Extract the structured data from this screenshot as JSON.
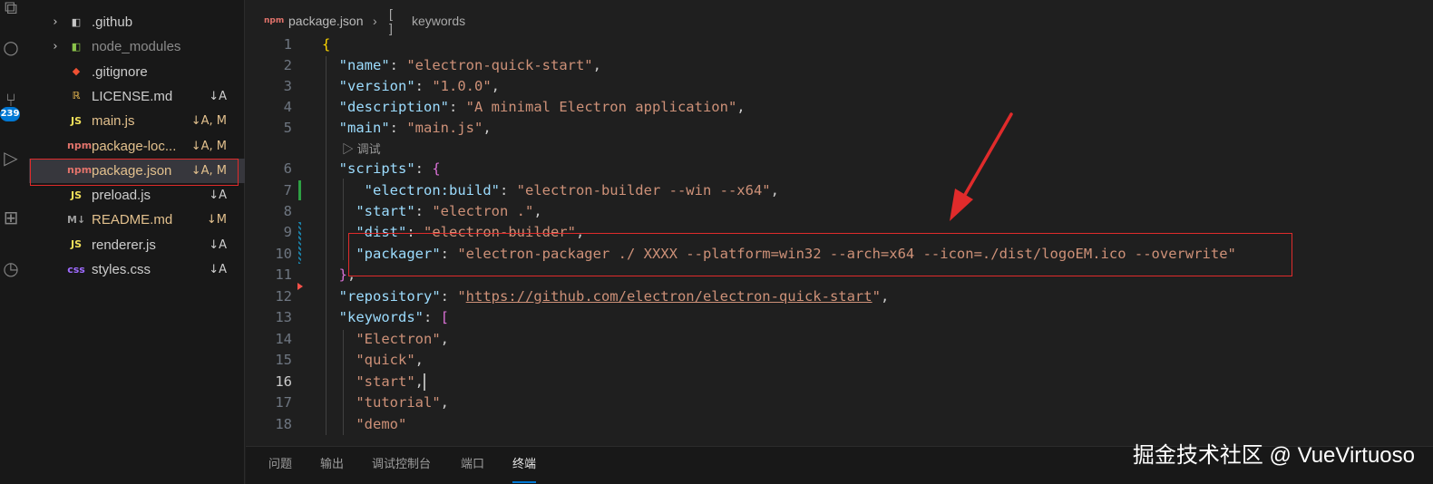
{
  "explorer": {
    "items": [
      {
        "name": ".github",
        "icon": "folder-github-icon",
        "status": "",
        "chevron": "›"
      },
      {
        "name": "node_modules",
        "icon": "folder-node-icon",
        "status": "",
        "chevron": "›"
      },
      {
        "name": ".gitignore",
        "icon": "git-icon",
        "status": ""
      },
      {
        "name": "LICENSE.md",
        "icon": "license-icon",
        "status": "↓A"
      },
      {
        "name": "main.js",
        "icon": "js-icon",
        "icon_text": "JS",
        "status": "↓A, M"
      },
      {
        "name": "package-loc...",
        "icon": "npm-icon",
        "icon_text": "npm",
        "status": "↓A, M"
      },
      {
        "name": "package.json",
        "icon": "npm-icon",
        "icon_text": "npm",
        "status": "↓A, M"
      },
      {
        "name": "preload.js",
        "icon": "js-icon",
        "icon_text": "JS",
        "status": "↓A"
      },
      {
        "name": "README.md",
        "icon": "markdown-icon",
        "icon_text": "M↓",
        "status": "↓M"
      },
      {
        "name": "renderer.js",
        "icon": "js-icon",
        "icon_text": "JS",
        "status": "↓A"
      },
      {
        "name": "styles.css",
        "icon": "css-icon",
        "icon_text": "css",
        "status": "↓A"
      }
    ]
  },
  "activity": {
    "badge": "239",
    "icons": [
      "explorer-icon",
      "search-icon",
      "source-control-icon",
      "run-debug-icon",
      "extensions-icon",
      "timeline-icon"
    ]
  },
  "breadcrumb": {
    "file": "package.json",
    "separator": "›",
    "symbol_icon": "[ ]",
    "symbol": "keywords"
  },
  "editor": {
    "codelens": "▷ 调试",
    "lines": [
      {
        "n": "1",
        "tokens": [
          [
            "b1",
            "{"
          ]
        ]
      },
      {
        "n": "2",
        "tokens": [
          [
            "p",
            "  "
          ],
          [
            "k",
            "\"name\""
          ],
          [
            "p",
            ": "
          ],
          [
            "s",
            "\"electron-quick-start\""
          ],
          [
            "p",
            ","
          ]
        ]
      },
      {
        "n": "3",
        "tokens": [
          [
            "p",
            "  "
          ],
          [
            "k",
            "\"version\""
          ],
          [
            "p",
            ": "
          ],
          [
            "s",
            "\"1.0.0\""
          ],
          [
            "p",
            ","
          ]
        ]
      },
      {
        "n": "4",
        "tokens": [
          [
            "p",
            "  "
          ],
          [
            "k",
            "\"description\""
          ],
          [
            "p",
            ": "
          ],
          [
            "s",
            "\"A minimal Electron application\""
          ],
          [
            "p",
            ","
          ]
        ]
      },
      {
        "n": "5",
        "tokens": [
          [
            "p",
            "  "
          ],
          [
            "k",
            "\"main\""
          ],
          [
            "p",
            ": "
          ],
          [
            "s",
            "\"main.js\""
          ],
          [
            "p",
            ","
          ]
        ]
      },
      {
        "n": "6",
        "tokens": [
          [
            "p",
            "  "
          ],
          [
            "k",
            "\"scripts\""
          ],
          [
            "p",
            ": "
          ],
          [
            "b2",
            "{"
          ]
        ]
      },
      {
        "n": "7",
        "tokens": [
          [
            "p",
            "     "
          ],
          [
            "k",
            "\"electron:build\""
          ],
          [
            "p",
            ": "
          ],
          [
            "s",
            "\"electron-builder --win --x64\""
          ],
          [
            "p",
            ","
          ]
        ]
      },
      {
        "n": "8",
        "tokens": [
          [
            "p",
            "    "
          ],
          [
            "k",
            "\"start\""
          ],
          [
            "p",
            ": "
          ],
          [
            "s",
            "\"electron .\""
          ],
          [
            "p",
            ","
          ]
        ]
      },
      {
        "n": "9",
        "tokens": [
          [
            "p",
            "    "
          ],
          [
            "k",
            "\"dist\""
          ],
          [
            "p",
            ": "
          ],
          [
            "s",
            "\"electron-builder\""
          ],
          [
            "p",
            ","
          ]
        ]
      },
      {
        "n": "10",
        "tokens": [
          [
            "p",
            "    "
          ],
          [
            "k",
            "\"packager\""
          ],
          [
            "p",
            ": "
          ],
          [
            "s",
            "\"electron-packager ./ XXXX --platform=win32 --arch=x64 --icon=./dist/logoEM.ico --overwrite\""
          ]
        ]
      },
      {
        "n": "11",
        "tokens": [
          [
            "p",
            "  "
          ],
          [
            "b2",
            "}"
          ],
          [
            "p",
            ","
          ]
        ]
      },
      {
        "n": "12",
        "tokens": [
          [
            "p",
            "  "
          ],
          [
            "k",
            "\"repository\""
          ],
          [
            "p",
            ": "
          ],
          [
            "s",
            "\""
          ],
          [
            "url",
            "https://github.com/electron/electron-quick-start"
          ],
          [
            "s",
            "\""
          ],
          [
            "p",
            ","
          ]
        ]
      },
      {
        "n": "13",
        "tokens": [
          [
            "p",
            "  "
          ],
          [
            "k",
            "\"keywords\""
          ],
          [
            "p",
            ": "
          ],
          [
            "b2",
            "["
          ]
        ]
      },
      {
        "n": "14",
        "tokens": [
          [
            "p",
            "    "
          ],
          [
            "s",
            "\"Electron\""
          ],
          [
            "p",
            ","
          ]
        ]
      },
      {
        "n": "15",
        "tokens": [
          [
            "p",
            "    "
          ],
          [
            "s",
            "\"quick\""
          ],
          [
            "p",
            ","
          ]
        ]
      },
      {
        "n": "16",
        "tokens": [
          [
            "p",
            "    "
          ],
          [
            "s",
            "\"start\""
          ],
          [
            "p",
            ","
          ],
          [
            "cursor",
            ""
          ]
        ]
      },
      {
        "n": "17",
        "tokens": [
          [
            "p",
            "    "
          ],
          [
            "s",
            "\"tutorial\""
          ],
          [
            "p",
            ","
          ]
        ]
      },
      {
        "n": "18",
        "tokens": [
          [
            "p",
            "    "
          ],
          [
            "s",
            "\"demo\""
          ]
        ]
      }
    ],
    "active_line": "16"
  },
  "panel": {
    "tabs": [
      "问题",
      "输出",
      "调试控制台",
      "端口",
      "终端"
    ],
    "active_tab": "终端"
  },
  "watermark": "掘金技术社区 @ VueVirtuoso",
  "colors": {
    "highlight": "#e02b2b",
    "arrow": "#e02b2b",
    "accent": "#0078d4"
  }
}
